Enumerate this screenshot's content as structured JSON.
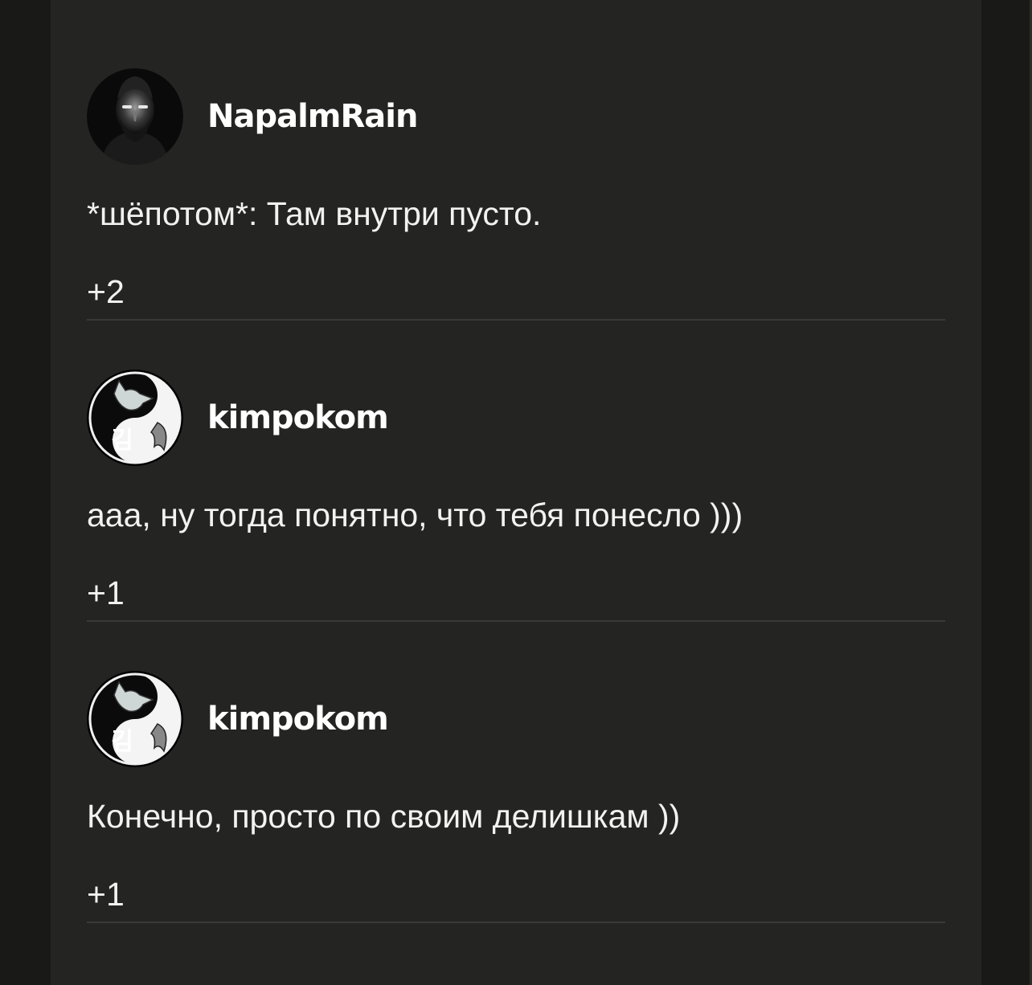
{
  "comments": [
    {
      "author": "NapalmRain",
      "avatar_icon": "bearded-man-avatar-icon",
      "text": "*шёпотом*: Там внутри пусто.",
      "votes": "+2"
    },
    {
      "author": "kimpokom",
      "avatar_icon": "fox-yin-yang-avatar-icon",
      "avatar_glyph": "김",
      "text": "ааа, ну тогда понятно, что тебя понесло )))",
      "votes": "+1"
    },
    {
      "author": "kimpokom",
      "avatar_icon": "fox-yin-yang-avatar-icon",
      "avatar_glyph": "김",
      "text": "Конечно, просто по своим делишкам ))",
      "votes": "+1"
    }
  ],
  "colors": {
    "background": "#191a17",
    "panel": "#242522",
    "text": "#f2f2f2",
    "divider": "#383a36"
  }
}
